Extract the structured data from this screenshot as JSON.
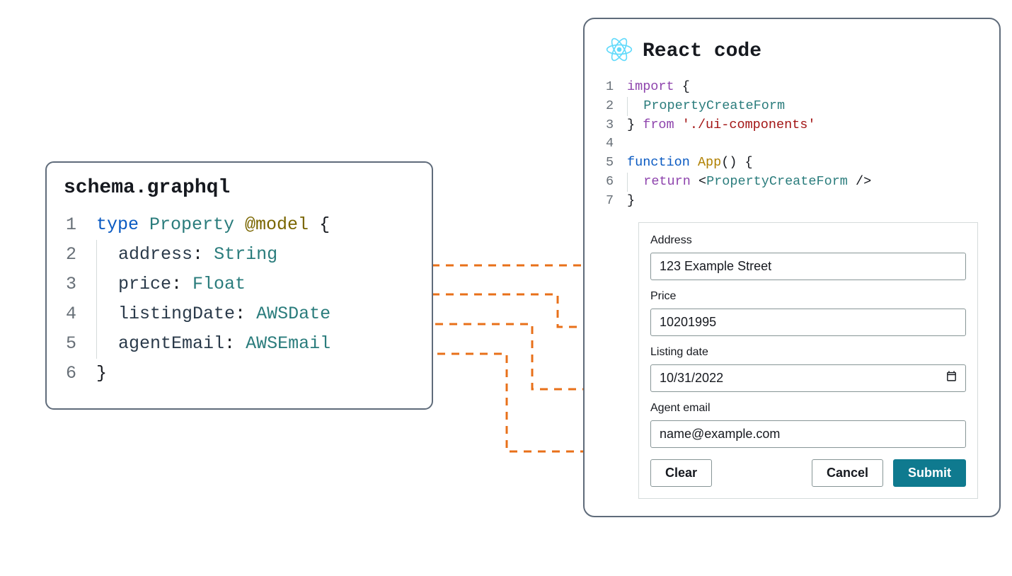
{
  "schema": {
    "filename": "schema.graphql",
    "lines": [
      {
        "n": "1",
        "tokens": [
          [
            "kw",
            "type "
          ],
          [
            "type",
            "Property "
          ],
          [
            "dir",
            "@model"
          ],
          [
            "punc",
            " {"
          ]
        ]
      },
      {
        "n": "2",
        "indent": true,
        "tokens": [
          [
            "field",
            "address"
          ],
          [
            "punc",
            ": "
          ],
          [
            "type",
            "String"
          ]
        ]
      },
      {
        "n": "3",
        "indent": true,
        "tokens": [
          [
            "field",
            "price"
          ],
          [
            "punc",
            ": "
          ],
          [
            "type",
            "Float"
          ]
        ]
      },
      {
        "n": "4",
        "indent": true,
        "tokens": [
          [
            "field",
            "listingDate"
          ],
          [
            "punc",
            ": "
          ],
          [
            "type",
            "AWSDate"
          ]
        ]
      },
      {
        "n": "5",
        "indent": true,
        "tokens": [
          [
            "field",
            "agentEmail"
          ],
          [
            "punc",
            ": "
          ],
          [
            "type",
            "AWSEmail"
          ]
        ]
      },
      {
        "n": "6",
        "tokens": [
          [
            "punc",
            "}"
          ]
        ]
      }
    ]
  },
  "react": {
    "title": "React code",
    "lines": [
      {
        "n": "1",
        "tokens": [
          [
            "purple",
            "import"
          ],
          [
            "punc",
            " {"
          ]
        ]
      },
      {
        "n": "2",
        "indent": true,
        "tokens": [
          [
            "comp",
            "PropertyCreateForm"
          ]
        ]
      },
      {
        "n": "3",
        "tokens": [
          [
            "punc",
            "} "
          ],
          [
            "purple",
            "from"
          ],
          [
            "punc",
            " "
          ],
          [
            "str",
            "'./ui-components'"
          ]
        ]
      },
      {
        "n": "4",
        "tokens": [
          [
            "punc",
            ""
          ]
        ]
      },
      {
        "n": "5",
        "tokens": [
          [
            "kw",
            "function"
          ],
          [
            "punc",
            " "
          ],
          [
            "fn",
            "App"
          ],
          [
            "punc",
            "() {"
          ]
        ]
      },
      {
        "n": "6",
        "indent": true,
        "tokens": [
          [
            "purple",
            "return"
          ],
          [
            "punc",
            " <"
          ],
          [
            "comp",
            "PropertyCreateForm"
          ],
          [
            "punc",
            " />"
          ]
        ]
      },
      {
        "n": "7",
        "tokens": [
          [
            "punc",
            "}"
          ]
        ]
      }
    ]
  },
  "form": {
    "fields": {
      "address": {
        "label": "Address",
        "value": "123 Example Street"
      },
      "price": {
        "label": "Price",
        "value": "10201995"
      },
      "listingDate": {
        "label": "Listing date",
        "value": "10/31/2022"
      },
      "agentEmail": {
        "label": "Agent email",
        "value": "name@example.com"
      }
    },
    "buttons": {
      "clear": "Clear",
      "cancel": "Cancel",
      "submit": "Submit"
    }
  },
  "colors": {
    "connector": "#e8701a",
    "accent": "#0f7a8f",
    "reactLogo": "#61dafb"
  }
}
